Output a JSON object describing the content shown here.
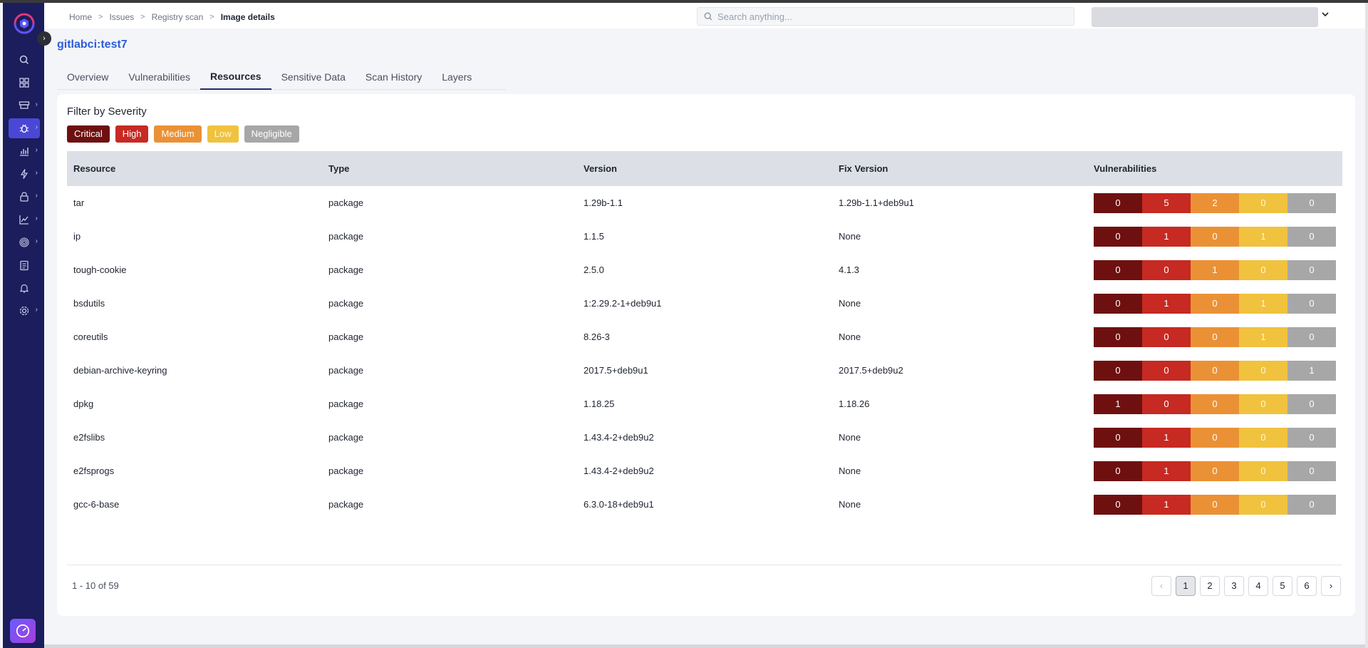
{
  "colors": {
    "sidebar_bg": "#1b1d5c",
    "accent": "#4b47d6",
    "title_blue": "#2b5dd9",
    "critical": "#6e1010",
    "high": "#c62a22",
    "medium": "#eb9135",
    "low": "#f0c23e",
    "negligible": "#a7a7a7"
  },
  "sidebar": {
    "items": [
      {
        "icon": "search-icon"
      },
      {
        "icon": "dashboard-grid-icon"
      },
      {
        "icon": "registry-icon"
      },
      {
        "icon": "bug-icon"
      },
      {
        "icon": "bar-chart-icon"
      },
      {
        "icon": "lightning-icon"
      },
      {
        "icon": "lock-icon"
      },
      {
        "icon": "trend-chart-icon"
      },
      {
        "icon": "fingerprint-icon"
      },
      {
        "icon": "clipboard-icon"
      },
      {
        "icon": "bell-icon"
      },
      {
        "icon": "gear-icon"
      }
    ]
  },
  "header": {
    "breadcrumb": [
      "Home",
      "Issues",
      "Registry scan",
      "Image details"
    ],
    "search_placeholder": "Search anything..."
  },
  "page": {
    "title": "gitlabci:test7",
    "tabs": [
      "Overview",
      "Vulnerabilities",
      "Resources",
      "Sensitive Data",
      "Scan History",
      "Layers"
    ],
    "active_tab": "Resources"
  },
  "filter": {
    "title": "Filter by Severity",
    "chips": [
      "Critical",
      "High",
      "Medium",
      "Low",
      "Negligible"
    ]
  },
  "table": {
    "headers": [
      "Resource",
      "Type",
      "Version",
      "Fix Version",
      "Vulnerabilities"
    ],
    "rows": [
      {
        "resource": "tar",
        "type": "package",
        "version": "1.29b-1.1",
        "fix": "1.29b-1.1+deb9u1",
        "v": [
          "0",
          "5",
          "2",
          "0",
          "0"
        ]
      },
      {
        "resource": "ip",
        "type": "package",
        "version": "1.1.5",
        "fix": "None",
        "v": [
          "0",
          "1",
          "0",
          "1",
          "0"
        ]
      },
      {
        "resource": "tough-cookie",
        "type": "package",
        "version": "2.5.0",
        "fix": "4.1.3",
        "v": [
          "0",
          "0",
          "1",
          "0",
          "0"
        ]
      },
      {
        "resource": "bsdutils",
        "type": "package",
        "version": "1:2.29.2-1+deb9u1",
        "fix": "None",
        "v": [
          "0",
          "1",
          "0",
          "1",
          "0"
        ]
      },
      {
        "resource": "coreutils",
        "type": "package",
        "version": "8.26-3",
        "fix": "None",
        "v": [
          "0",
          "0",
          "0",
          "1",
          "0"
        ]
      },
      {
        "resource": "debian-archive-keyring",
        "type": "package",
        "version": "2017.5+deb9u1",
        "fix": "2017.5+deb9u2",
        "v": [
          "0",
          "0",
          "0",
          "0",
          "1"
        ]
      },
      {
        "resource": "dpkg",
        "type": "package",
        "version": "1.18.25",
        "fix": "1.18.26",
        "v": [
          "1",
          "0",
          "0",
          "0",
          "0"
        ]
      },
      {
        "resource": "e2fslibs",
        "type": "package",
        "version": "1.43.4-2+deb9u2",
        "fix": "None",
        "v": [
          "0",
          "1",
          "0",
          "0",
          "0"
        ]
      },
      {
        "resource": "e2fsprogs",
        "type": "package",
        "version": "1.43.4-2+deb9u2",
        "fix": "None",
        "v": [
          "0",
          "1",
          "0",
          "0",
          "0"
        ]
      },
      {
        "resource": "gcc-6-base",
        "type": "package",
        "version": "6.3.0-18+deb9u1",
        "fix": "None",
        "v": [
          "0",
          "1",
          "0",
          "0",
          "0"
        ]
      }
    ]
  },
  "pagination": {
    "range": "1 - 10 of 59",
    "pages": [
      "1",
      "2",
      "3",
      "4",
      "5",
      "6"
    ],
    "current": "1",
    "prev": "‹",
    "next": "›"
  }
}
